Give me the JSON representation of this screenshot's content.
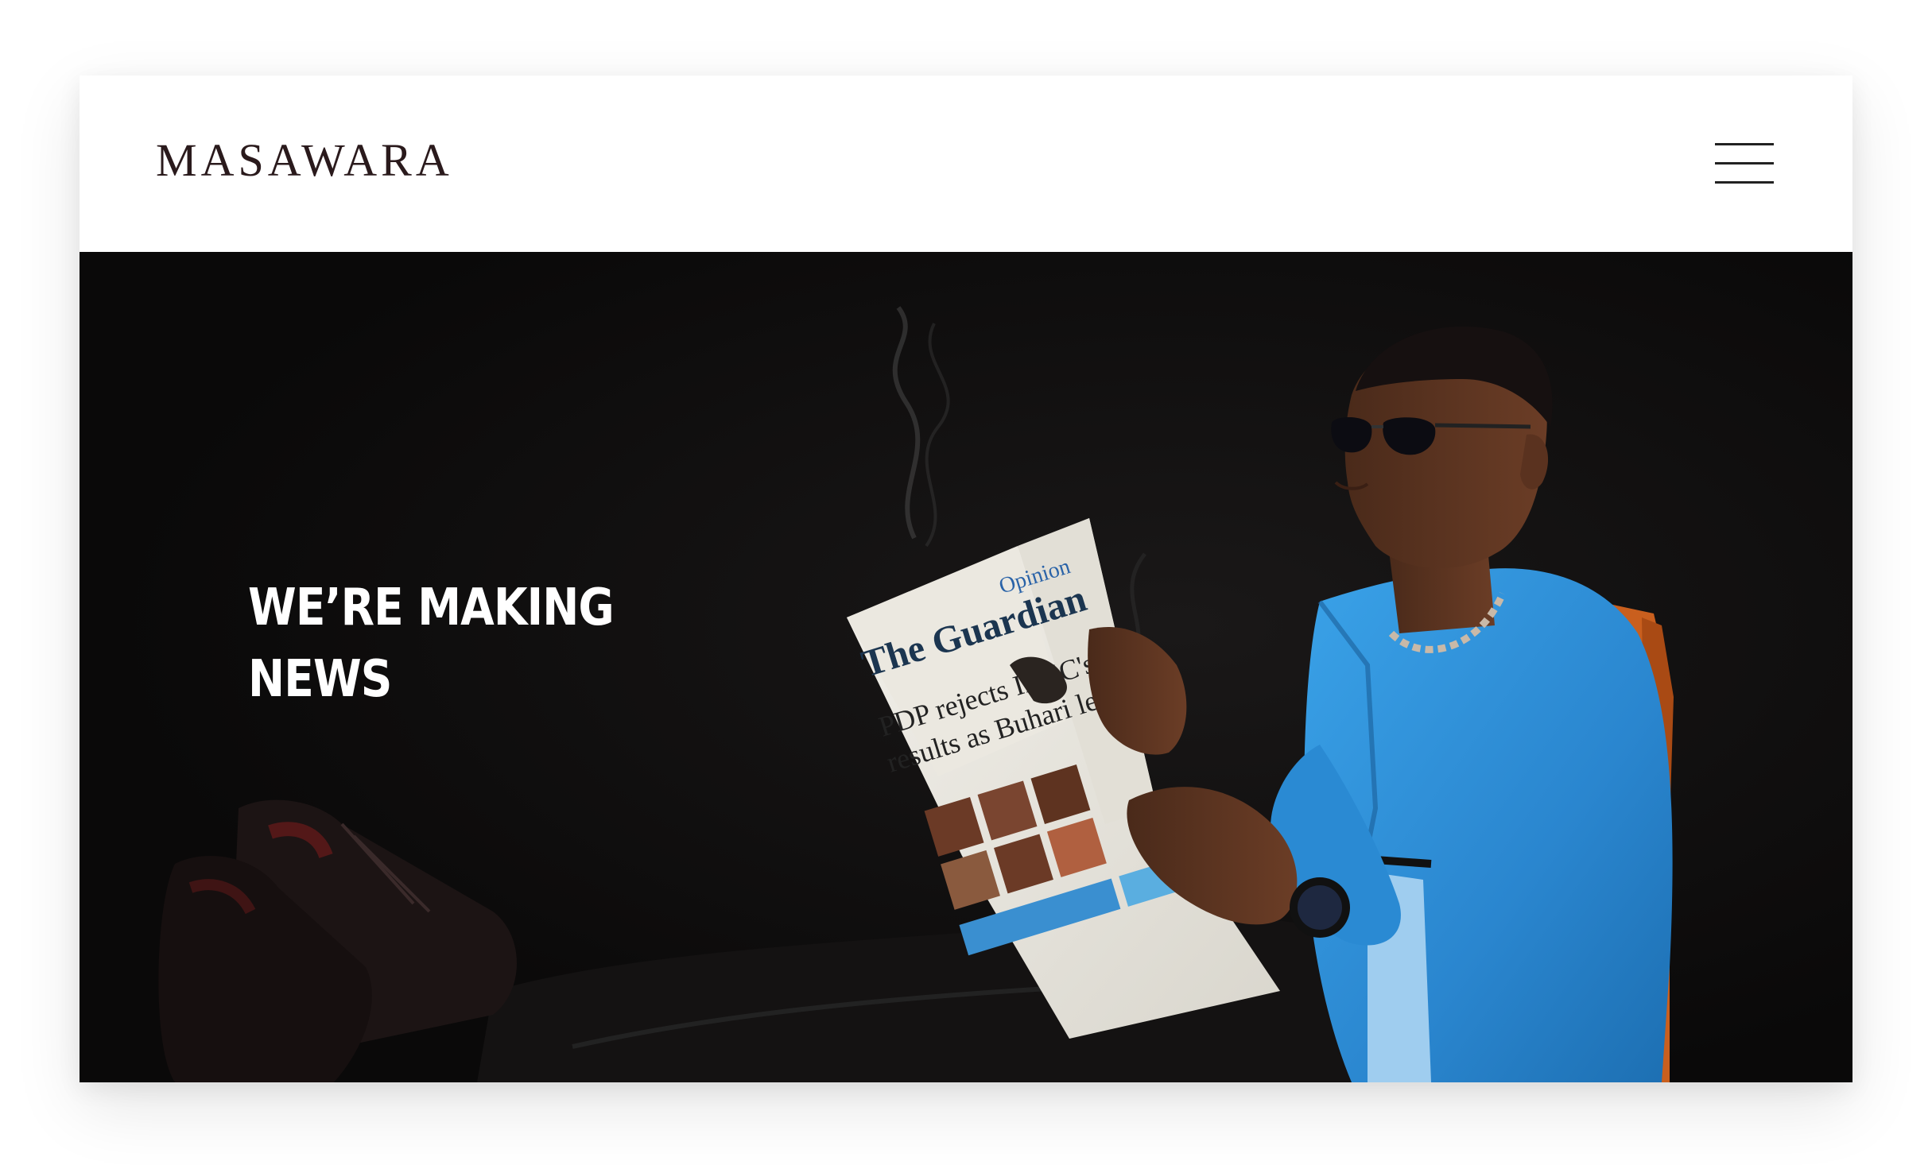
{
  "header": {
    "logo_text": "MASAWARA",
    "menu_icon": "hamburger-menu-icon"
  },
  "hero": {
    "headline_line1": "WE’RE MAKING",
    "headline_line2": "NEWS",
    "photo_subject": "man-reading-newspaper-photo",
    "newspaper": {
      "masthead": "The Guardian",
      "section": "Opinion",
      "headline": "PDP rejects INEC's poll results as Buhari leads"
    }
  },
  "colors": {
    "logo": "#2a1a1c",
    "hero_background": "#0c0b0b",
    "headline": "#ffffff",
    "jacket_blue": "#2f8fd6",
    "chair_orange": "#c95f1e"
  }
}
